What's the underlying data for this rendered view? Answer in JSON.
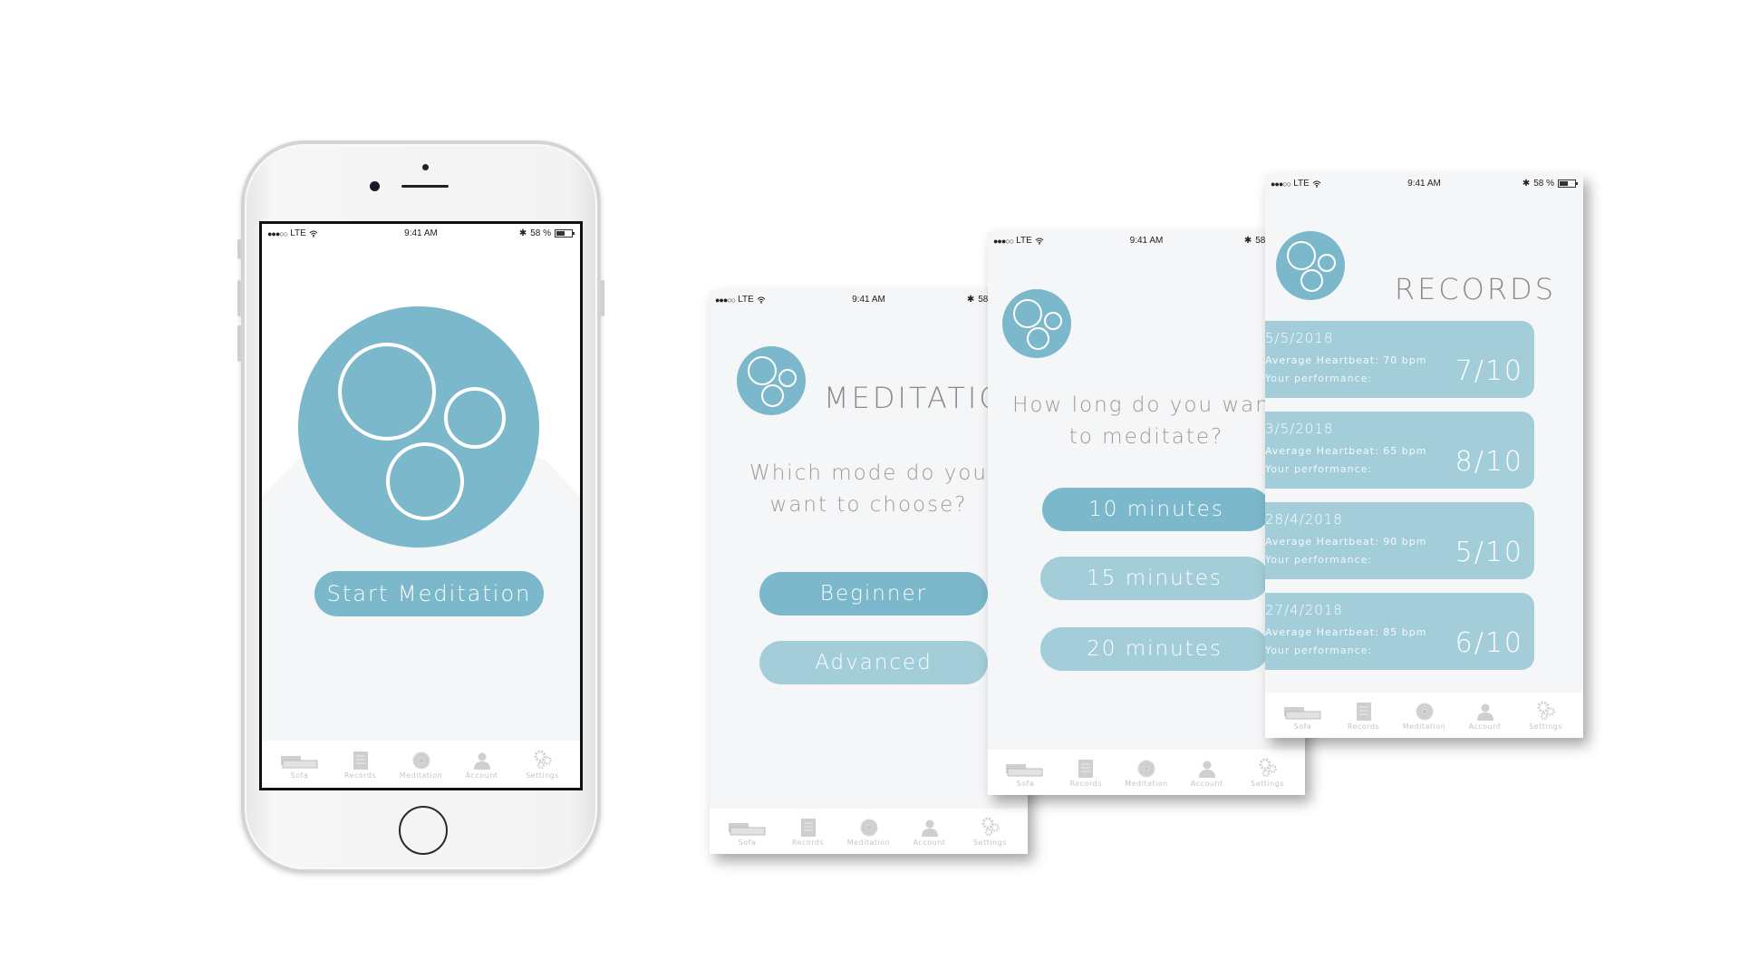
{
  "status_bar": {
    "signal": "●●●○○",
    "carrier": "LTE",
    "wifi_icon": "wifi-icon",
    "time": "9:41 AM",
    "bluetooth_icon": "bluetooth-icon",
    "battery": "58 %"
  },
  "colors": {
    "accent": "#7bb8cc",
    "accent_light": "#a3ced9",
    "screen_bg": "#f5f6f8",
    "title_gray": "#8a8a8a",
    "tab_gray": "#c4c4c4"
  },
  "tab_bar": {
    "items": [
      {
        "label": "Sofa",
        "icon": "sofa-icon"
      },
      {
        "label": "Records",
        "icon": "records-icon"
      },
      {
        "label": "Meditation",
        "icon": "meditation-icon"
      },
      {
        "label": "Account",
        "icon": "account-icon"
      },
      {
        "label": "Settings",
        "icon": "settings-icon"
      }
    ]
  },
  "home_screen": {
    "start_button": "Start Meditation"
  },
  "mode_screen": {
    "title": "MEDITATION",
    "question_line1": "Which mode do you",
    "question_line2": "want to choose?",
    "options": [
      "Beginner",
      "Advanced"
    ]
  },
  "duration_screen": {
    "question_line1": "How long do you want",
    "question_line2": "to meditate?",
    "options": [
      "10 minutes",
      "15 minutes",
      "20 minutes"
    ]
  },
  "records_screen": {
    "title": "RECORDS",
    "records": [
      {
        "date": "5/5/2018",
        "heartbeat": "Average Heartbeat: 70 bpm",
        "performance_label": "Your performance:",
        "score": "7/10"
      },
      {
        "date": "3/5/2018",
        "heartbeat": "Average Heartbeat: 65 bpm",
        "performance_label": "Your performance:",
        "score": "8/10"
      },
      {
        "date": "28/4/2018",
        "heartbeat": "Average Heartbeat: 90 bpm",
        "performance_label": "Your performance:",
        "score": "5/10"
      },
      {
        "date": "27/4/2018",
        "heartbeat": "Average Heartbeat: 85 bpm",
        "performance_label": "Your performance:",
        "score": "6/10"
      }
    ]
  }
}
